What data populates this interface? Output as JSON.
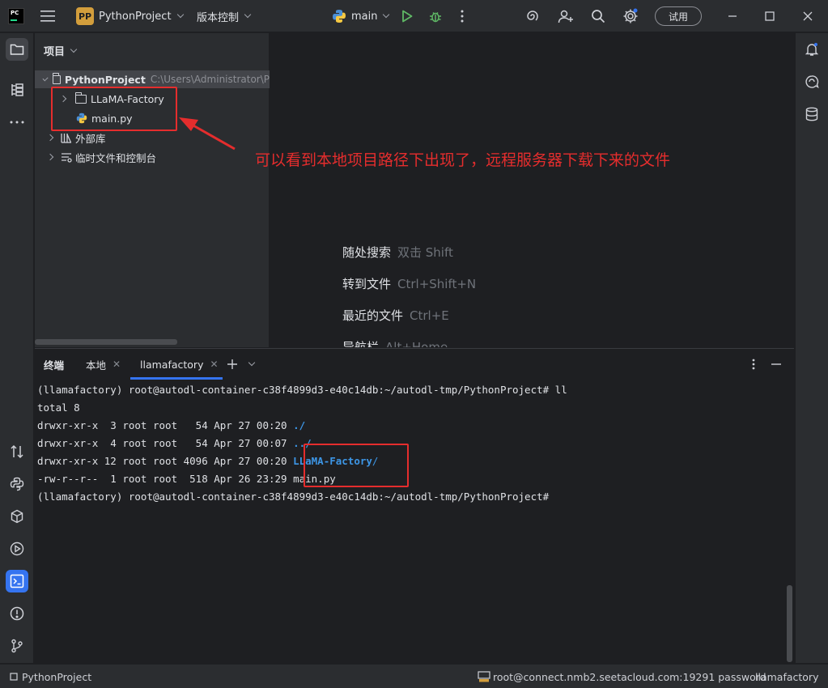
{
  "titlebar": {
    "logo_text": "PC",
    "project_badge": "PP",
    "project_name": "PythonProject",
    "vcs_menu": "版本控制",
    "branch": "main",
    "trial_button": "试用"
  },
  "project_panel": {
    "title": "项目",
    "tree": [
      {
        "label": "PythonProject",
        "path": "C:\\Users\\Administrator\\P"
      },
      {
        "label": "LLaMA-Factory"
      },
      {
        "label": "main.py"
      },
      {
        "label": "外部库"
      },
      {
        "label": "临时文件和控制台"
      }
    ]
  },
  "annotation": {
    "text": "可以看到本地项目路径下出现了，远程服务器下载下来的文件"
  },
  "editor_hints": [
    {
      "label": "随处搜索",
      "key": "双击 Shift"
    },
    {
      "label": "转到文件",
      "key": "Ctrl+Shift+N"
    },
    {
      "label": "最近的文件",
      "key": "Ctrl+E"
    },
    {
      "label": "导航栏",
      "key": "Alt+Home"
    }
  ],
  "terminal": {
    "title": "终端",
    "tabs": [
      {
        "label": "本地"
      },
      {
        "label": "llamafactory"
      }
    ],
    "lines": [
      "(llamafactory) root@autodl-container-c38f4899d3-e40c14db:~/autodl-tmp/PythonProject# ll",
      "total 8",
      {
        "prefix": "drwxr-xr-x  3 root root   54 Apr 27 00:20 ",
        "name": "./"
      },
      {
        "prefix": "drwxr-xr-x  4 root root   54 Apr 27 00:07 ",
        "name": "../"
      },
      {
        "prefix": "drwxr-xr-x 12 root root 4096 Apr 27 00:20 ",
        "name": "LLaMA-Factory",
        "suffix": "/"
      },
      {
        "prefix": "-rw-r--r--  1 root root  518 Apr 26 23:29 ",
        "name": "main.py"
      },
      "(llamafactory) root@autodl-container-c38f4899d3-e40c14db:~/autodl-tmp/PythonProject#"
    ]
  },
  "statusbar": {
    "project": "PythonProject",
    "connection": "root@connect.nmb2.seetacloud.com:19291 password",
    "interpreter": "llamafactory"
  },
  "colors": {
    "accent": "#3574f0",
    "annotation": "#e52d2d",
    "dir_blue": "#3d96e6",
    "run_green": "#5fb865"
  }
}
